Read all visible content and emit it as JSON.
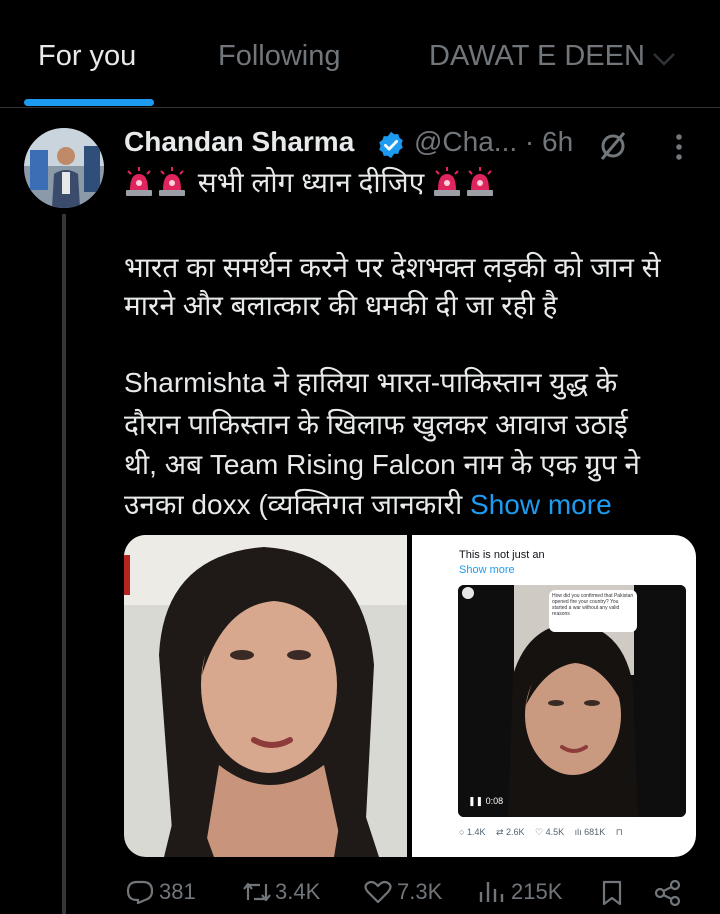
{
  "tabs": {
    "items": [
      {
        "label": "For you",
        "active": true
      },
      {
        "label": "Following",
        "active": false
      },
      {
        "label": "DAWAT E DEEN",
        "active": false
      }
    ]
  },
  "tweet": {
    "author_name": "Chandan Sharma",
    "handle": "@Cha...",
    "time": "· 6h",
    "text_line_1": "सभी लोग ध्यान दीजिए",
    "text_line_2": "भारत का समर्थन करने पर देशभक्त लड़की को जान से",
    "text_line_3": "मारने और बलात्कार की धमकी दी जा रही है",
    "text_line_4": "Sharmishta ने हालिया भारत-पाकिस्तान युद्ध के",
    "text_line_5": "दौरान पाकिस्तान के खिलाफ खुलकर आवाज उठाई",
    "text_line_6": "थी, अब Team Rising Falcon नाम के एक ग्रुप ने",
    "text_line_7": "उनका doxx (व्यक्तिगत जानकारी",
    "show_more": "Show more",
    "embedded_post": {
      "title": "This is not just an",
      "show_more": "Show more",
      "bubble_text": "How did you confirmed that Pakistan opened fire your country? You started a war without any valid reasons",
      "video_time": "0:08",
      "stats": {
        "replies": "1.4K",
        "reposts": "2.6K",
        "likes": "4.5K",
        "views": "681K"
      }
    },
    "actions": {
      "replies": "381",
      "reposts": "3.4K",
      "likes": "7.3K",
      "views": "215K"
    }
  },
  "colors": {
    "accent": "#1d9bf0",
    "background": "#000000",
    "muted": "#71767b",
    "alarm": "#e0245e"
  }
}
